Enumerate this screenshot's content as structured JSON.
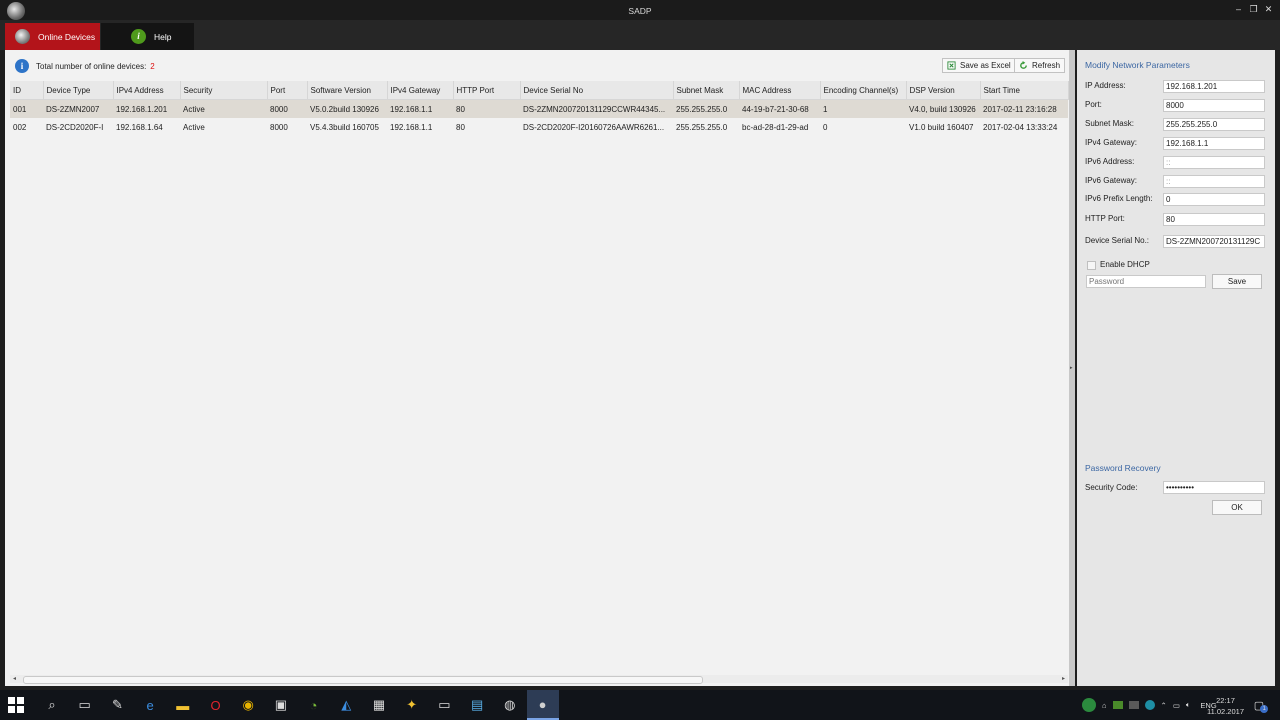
{
  "window": {
    "title": "SADP"
  },
  "tabs": [
    {
      "label": "Online Devices",
      "active": true
    },
    {
      "label": "Help",
      "active": false
    }
  ],
  "summary": {
    "label": "Total number of online devices:",
    "count": "2"
  },
  "toolbar": {
    "save_excel": "Save as Excel",
    "refresh": "Refresh"
  },
  "table": {
    "columns": [
      "ID",
      "Device Type",
      "IPv4 Address",
      "Security",
      "Port",
      "Software Version",
      "IPv4 Gateway",
      "HTTP Port",
      "Device Serial No",
      "Subnet Mask",
      "MAC Address",
      "Encoding Channel(s)",
      "DSP Version",
      "Start Time"
    ],
    "rows": [
      {
        "selected": true,
        "cells": [
          "001",
          "DS-2ZMN2007",
          "192.168.1.201",
          "Active",
          "8000",
          "V5.0.2build 130926",
          "192.168.1.1",
          "80",
          "DS-2ZMN200720131129CCWR44345...",
          "255.255.255.0",
          "44-19-b7-21-30-68",
          "1",
          "V4.0, build 130926",
          "2017-02-11 23:16:28"
        ]
      },
      {
        "selected": false,
        "cells": [
          "002",
          "DS-2CD2020F-I",
          "192.168.1.64",
          "Active",
          "8000",
          "V5.4.3build 160705",
          "192.168.1.1",
          "80",
          "DS-2CD2020F-I20160726AAWR6261...",
          "255.255.255.0",
          "bc-ad-28-d1-29-ad",
          "0",
          "V1.0 build 160407",
          "2017-02-04 13:33:24"
        ]
      }
    ]
  },
  "panel": {
    "title": "Modify Network Parameters",
    "fields": [
      {
        "label": "IP Address:",
        "value": "192.168.1.201",
        "disabled": false
      },
      {
        "label": "Port:",
        "value": "8000",
        "disabled": false
      },
      {
        "label": "Subnet Mask:",
        "value": "255.255.255.0",
        "disabled": false
      },
      {
        "label": "IPv4 Gateway:",
        "value": "192.168.1.1",
        "disabled": false
      },
      {
        "label": "IPv6 Address:",
        "value": "::",
        "disabled": true
      },
      {
        "label": "IPv6 Gateway:",
        "value": "::",
        "disabled": true
      },
      {
        "label": "IPv6 Prefix Length:",
        "value": "0",
        "disabled": false
      },
      {
        "label": "HTTP Port:",
        "value": "80",
        "disabled": false
      },
      {
        "label": "Device Serial No.:",
        "value": "DS-2ZMN200720131129C",
        "disabled": false
      }
    ],
    "dhcp_label": "Enable DHCP",
    "password_placeholder": "Password",
    "save_label": "Save",
    "recovery_title": "Password Recovery",
    "security_code_label": "Security Code:",
    "security_code_value": "••••••••••",
    "ok_label": "OK"
  },
  "taskbar": {
    "apps": [
      "search-icon",
      "task-view-icon",
      "pen-app-icon",
      "edge-icon",
      "file-explorer-icon",
      "opera-icon",
      "chrome-icon",
      "store-icon",
      "wifi-app-icon",
      "maps-app-icon",
      "network-tool-icon",
      "wing-app-icon",
      "terminal-icon",
      "connect-app-icon",
      "network-globe-icon",
      "sadp-app-icon"
    ],
    "language": "ENG",
    "time": "22:17",
    "date": "11.02.2017",
    "notification_count": "1"
  }
}
